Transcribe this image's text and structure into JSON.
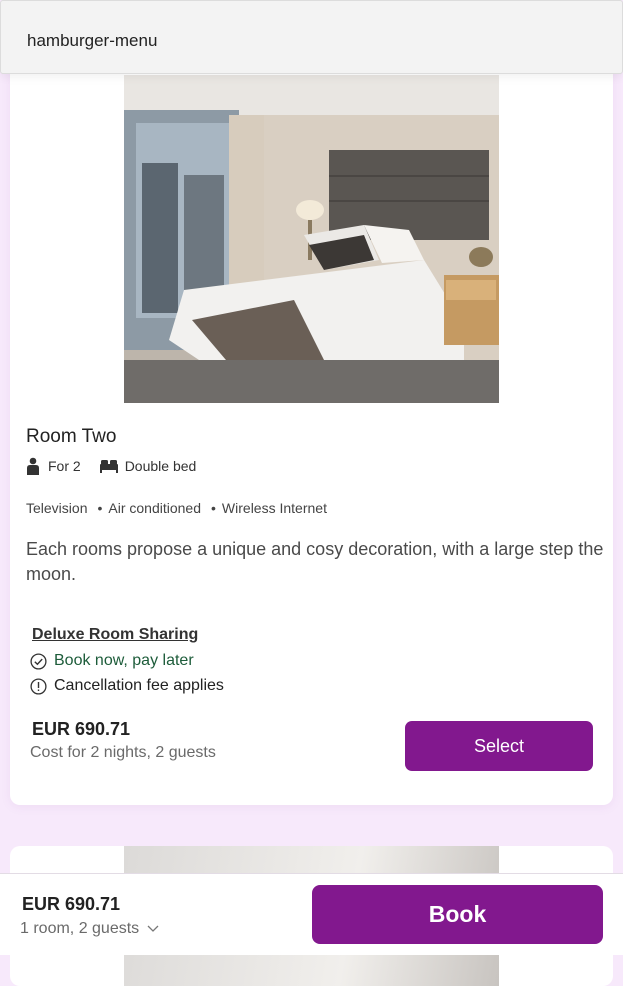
{
  "header": {
    "menu_label": "hamburger-menu"
  },
  "room": {
    "name": "Room Two",
    "capacity": "For 2",
    "bed": "Double bed",
    "amenities": [
      "Television",
      "Air conditioned",
      "Wireless Internet"
    ],
    "description": "Each rooms propose a unique and cosy decoration, with a large step the moon.",
    "rate": {
      "name": "Deluxe Room Sharing",
      "payment_note": "Book now, pay later",
      "cancellation_note": "Cancellation fee applies",
      "price": "EUR 690.71",
      "price_detail": "Cost for 2 nights, 2 guests",
      "select_label": "Select"
    }
  },
  "footer": {
    "price": "EUR 690.71",
    "summary": "1 room, 2 guests",
    "book_label": "Book"
  },
  "colors": {
    "accent": "#82188e",
    "page_bg": "#f7e9fb",
    "success_text": "#1d5c3a"
  }
}
